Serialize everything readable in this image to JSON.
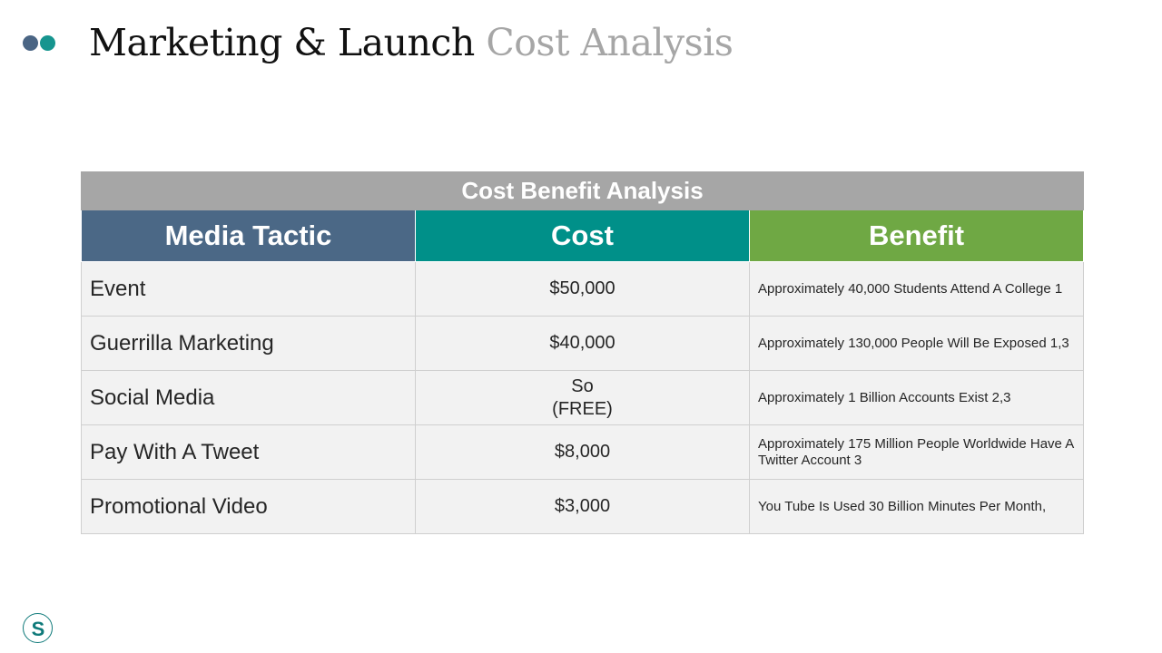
{
  "slide": {
    "title_main": "Marketing & Launch",
    "title_sub": "Cost Analysis"
  },
  "colors": {
    "dot_left": "#4a6584",
    "dot_right": "#16958f",
    "caption_bg": "#a6a6a6",
    "media_header": "#4b6886",
    "cost_header": "#009089",
    "benefit_header": "#6fa844",
    "row_bg": "#f2f2f2",
    "logo": "#0f7a7a"
  },
  "table": {
    "caption": "Cost Benefit Analysis",
    "headers": [
      "Media Tactic",
      "Cost",
      "Benefit"
    ],
    "rows": [
      {
        "tactic": "Event",
        "cost": [
          "$50,000"
        ],
        "benefit": "Approximately 40,000 Students Attend A College 1"
      },
      {
        "tactic": "Guerrilla Marketing",
        "cost": [
          "$40,000"
        ],
        "benefit": "Approximately 130,000 People Will Be Exposed 1,3"
      },
      {
        "tactic": "Social Media",
        "cost": [
          "So",
          "(FREE)"
        ],
        "benefit": "Approximately 1 Billion Accounts Exist 2,3"
      },
      {
        "tactic": "Pay With A Tweet",
        "cost": [
          "$8,000"
        ],
        "benefit": "Approximately 175 Million People Worldwide Have A Twitter Account 3"
      },
      {
        "tactic": "Promotional Video",
        "cost": [
          "$3,000"
        ],
        "benefit": "You Tube Is Used 30 Billion Minutes Per Month,"
      }
    ]
  },
  "logo": {
    "icon": "s-logo-icon",
    "letter": "S"
  }
}
